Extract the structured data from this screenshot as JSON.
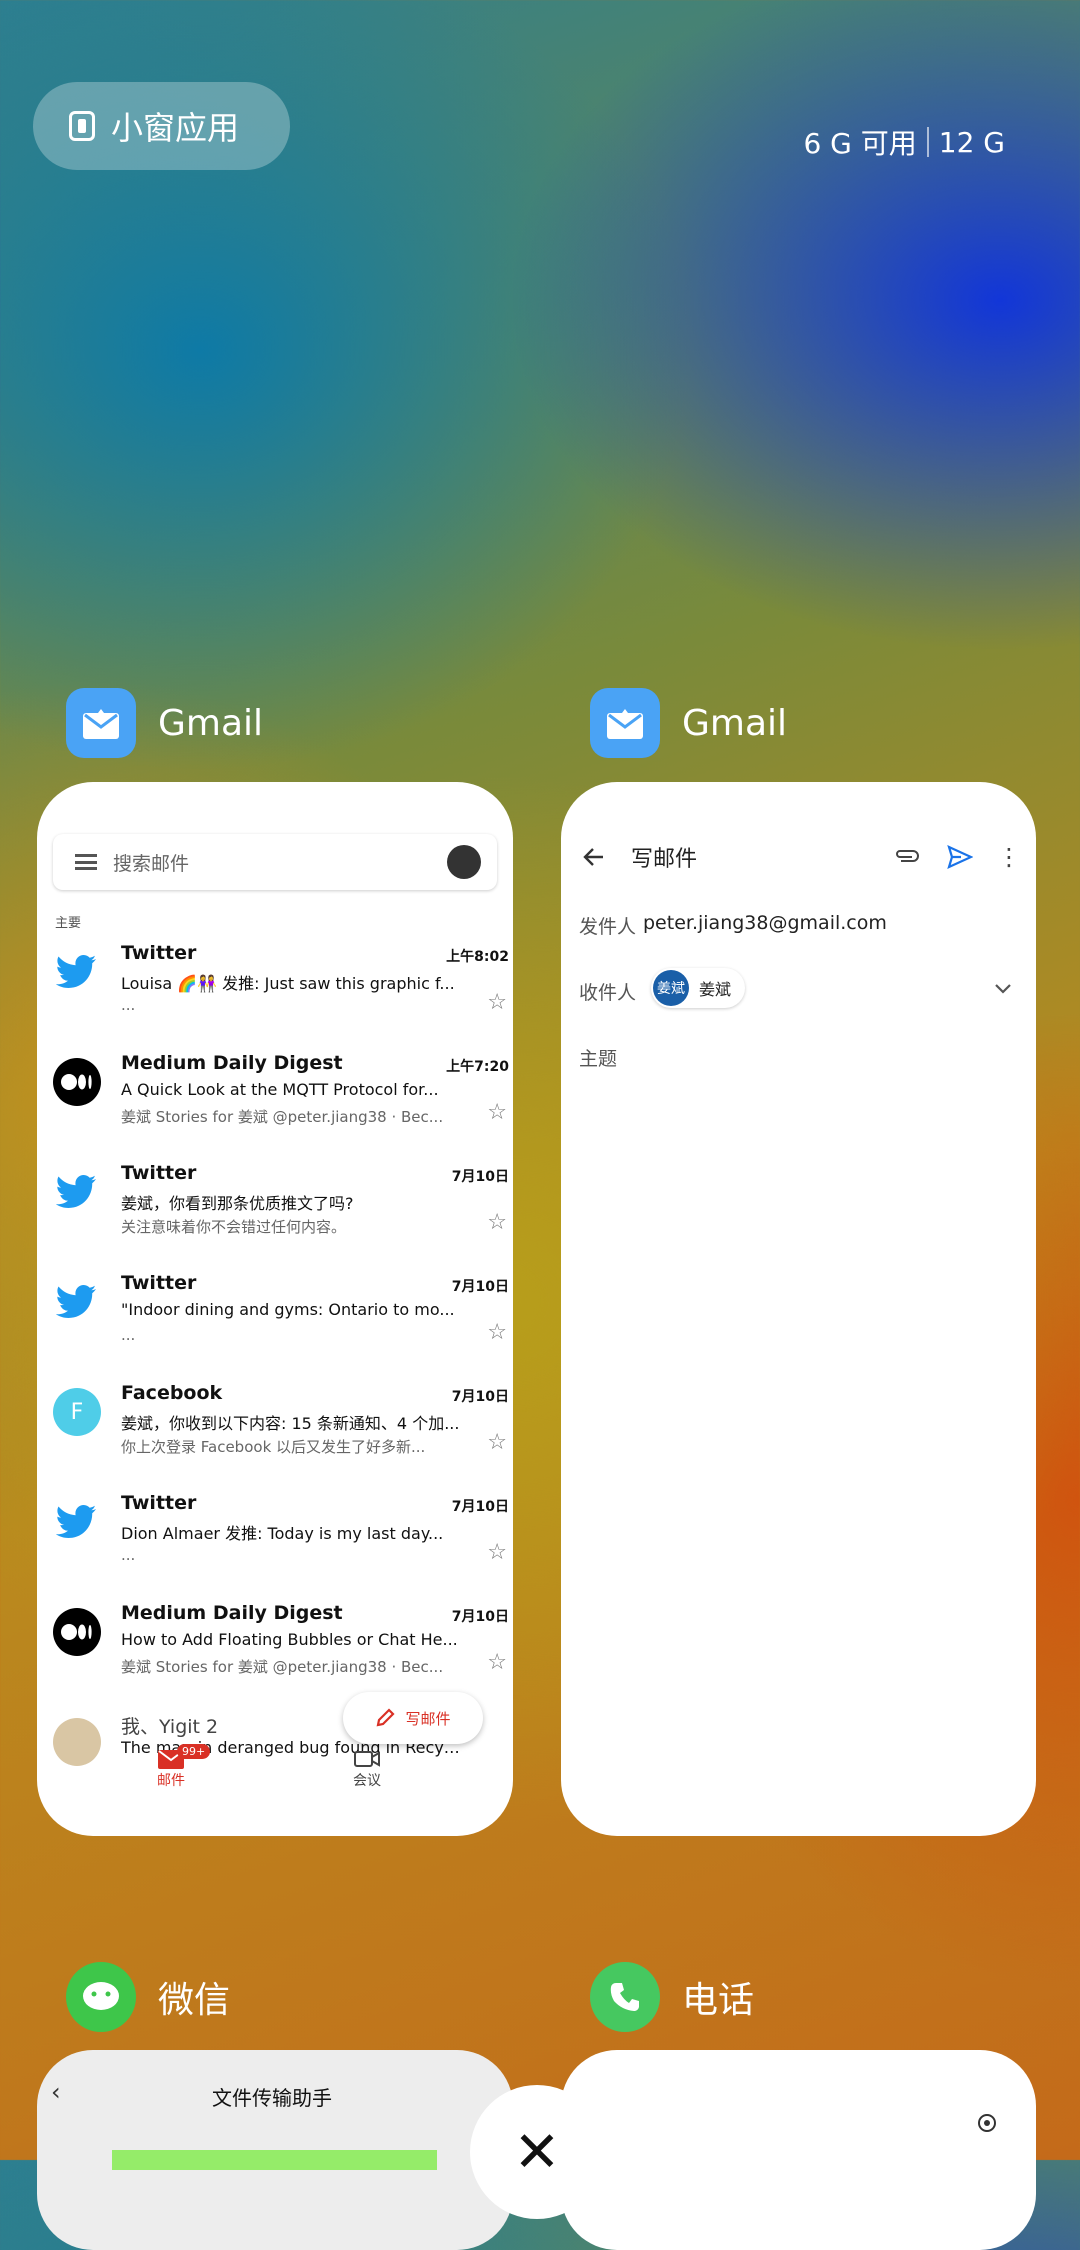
{
  "top": {
    "small_window_label": "小窗应用",
    "memory_available": "6 G 可用",
    "memory_total": "12 G"
  },
  "apps": {
    "gmail1_name": "Gmail",
    "gmail2_name": "Gmail",
    "wechat_name": "微信",
    "phone_name": "电话"
  },
  "inbox": {
    "search_placeholder": "搜索邮件",
    "section": "主要",
    "mails": [
      {
        "sender": "Twitter",
        "date": "上午8:02",
        "subject": "Louisa 🌈👭 发推: Just saw this graphic f...",
        "snippet": "..."
      },
      {
        "sender": "Medium Daily Digest",
        "date": "上午7:20",
        "subject": "A Quick Look at the MQTT Protocol for...",
        "snippet": "姜斌 Stories for 姜斌 @peter.jiang38 · Bec..."
      },
      {
        "sender": "Twitter",
        "date": "7月10日",
        "subject": "姜斌，你看到那条优质推文了吗?",
        "snippet": "关注意味着你不会错过任何内容。"
      },
      {
        "sender": "Twitter",
        "date": "7月10日",
        "subject": "\"Indoor dining and gyms: Ontario to mo...",
        "snippet": "..."
      },
      {
        "sender": "Facebook",
        "date": "7月10日",
        "subject": "姜斌，你收到以下内容: 15 条新通知、4 个加...",
        "snippet": "你上次登录 Facebook 以后又发生了好多新..."
      },
      {
        "sender": "Twitter",
        "date": "7月10日",
        "subject": "Dion Almaer 发推: Today is my last day...",
        "snippet": "..."
      },
      {
        "sender": "Medium Daily Digest",
        "date": "7月10日",
        "subject": "How to Add Floating Bubbles or Chat He...",
        "snippet": "姜斌 Stories for 姜斌 @peter.jiang38 · Bec..."
      },
      {
        "sender": "我、Yigit 2",
        "date": "",
        "subject": "The margin deranged bug found in Recycl...",
        "snippet": ""
      }
    ],
    "fab_label": "写邮件",
    "nav_mail": "邮件",
    "nav_mail_badge": "99+",
    "nav_meet": "会议",
    "facebook_letter": "F"
  },
  "compose": {
    "title": "写邮件",
    "from_label": "发件人",
    "from_value": "peter.jiang38@gmail.com",
    "to_label": "收件人",
    "to_chip": "姜斌",
    "to_chip_avatar": "姜斌",
    "subject_label": "主题"
  },
  "wechat_card": {
    "title": "文件传输助手"
  }
}
